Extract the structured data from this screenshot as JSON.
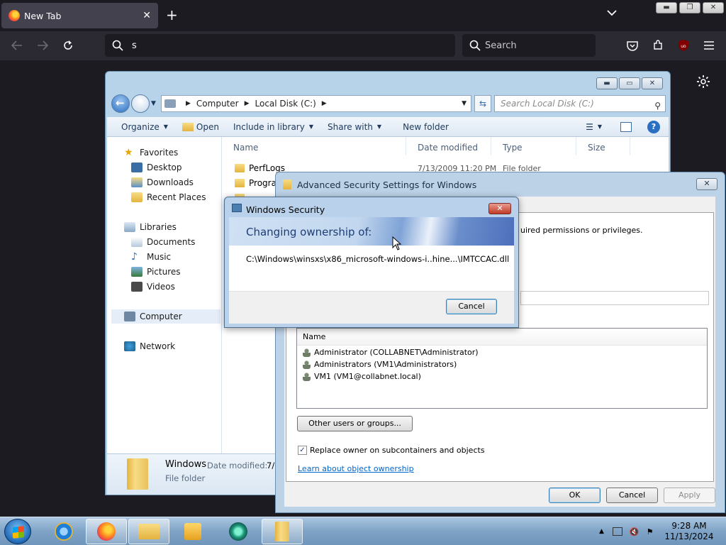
{
  "firefox": {
    "tab_title": "New Tab",
    "url_value": "s",
    "search_placeholder": "Search"
  },
  "explorer": {
    "breadcrumb": [
      "Computer",
      "Local Disk (C:)"
    ],
    "search_placeholder": "Search Local Disk (C:)",
    "toolbar": {
      "organize": "Organize",
      "open": "Open",
      "include": "Include in library",
      "share": "Share with",
      "new_folder": "New folder"
    },
    "nav": {
      "favorites": "Favorites",
      "desktop": "Desktop",
      "downloads": "Downloads",
      "recent": "Recent Places",
      "libraries": "Libraries",
      "documents": "Documents",
      "music": "Music",
      "pictures": "Pictures",
      "videos": "Videos",
      "computer": "Computer",
      "network": "Network"
    },
    "columns": {
      "name": "Name",
      "date": "Date modified",
      "type": "Type",
      "size": "Size"
    },
    "files": [
      {
        "name": "PerfLogs",
        "date": "7/13/2009 11:20 PM",
        "type": "File folder"
      },
      {
        "name": "Progra"
      }
    ],
    "status": {
      "name": "Windows",
      "date_label": "Date modified:",
      "date_value": "7/",
      "type": "File folder"
    }
  },
  "advanced": {
    "title": "Advanced Security Settings for Windows",
    "info_text": "uired permissions or privileges.",
    "list_header": "Name",
    "users": [
      "Administrator (COLLABNET\\Administrator)",
      "Administrators (VM1\\Administrators)",
      "VM1 (VM1@collabnet.local)"
    ],
    "other_users_button": "Other users or groups...",
    "replace_owner_label": "Replace owner on subcontainers and objects",
    "replace_owner_checked": true,
    "learn_link": "Learn about object ownership",
    "ok": "OK",
    "cancel": "Cancel",
    "apply": "Apply"
  },
  "security": {
    "title": "Windows Security",
    "heading": "Changing ownership of:",
    "path": "C:\\Windows\\winsxs\\x86_microsoft-windows-i..hine...\\IMTCCAC.dll",
    "cancel": "Cancel"
  },
  "taskbar": {
    "time": "9:28 AM",
    "date": "11/13/2024"
  }
}
